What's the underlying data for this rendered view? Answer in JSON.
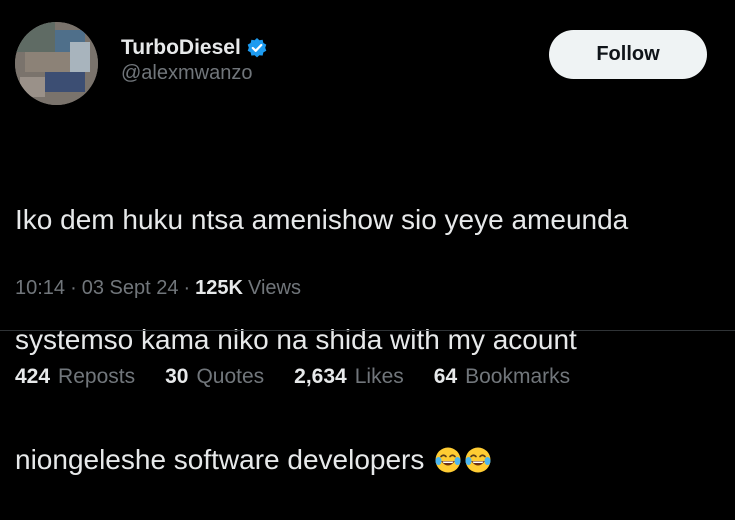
{
  "author": {
    "display_name": "TurboDiesel",
    "handle": "@alexmwanzo",
    "verified": true,
    "verified_color": "#1d9bf0"
  },
  "follow_button": {
    "label": "Follow"
  },
  "tweet": {
    "lines": [
      "Iko dem huku ntsa amenishow sio yeye ameunda",
      "systemso kama niko na shida with my acount",
      "niongeleshe software developers"
    ],
    "emojis": [
      "face-with-tears-of-joy-icon",
      "face-with-tears-of-joy-icon"
    ]
  },
  "meta": {
    "time": "10:14",
    "separator": "·",
    "date": "03 Sept 24",
    "views_count": "125K",
    "views_label": "Views"
  },
  "stats": {
    "reposts_count": "424",
    "reposts_label": "Reposts",
    "quotes_count": "30",
    "quotes_label": "Quotes",
    "likes_count": "2,634",
    "likes_label": "Likes",
    "bookmarks_count": "64",
    "bookmarks_label": "Bookmarks"
  },
  "colors": {
    "background": "#000000",
    "primary_text": "#e7e9ea",
    "secondary_text": "#71767b",
    "divider": "#2f3336",
    "button_bg": "#eff3f4",
    "button_text": "#0f1419"
  }
}
